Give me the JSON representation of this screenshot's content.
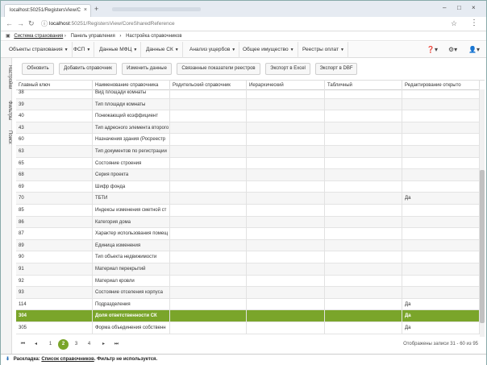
{
  "browser": {
    "tab_title": "localhost:50251/RegistersView/C",
    "url_host": "localhost",
    "url_rest": ":50251/RegistersView/CoreSharedReference"
  },
  "breadcrumb": [
    "Система страхования",
    "Панель управления",
    "Настройка справочников"
  ],
  "navbar": [
    "Объекты страхования",
    "ФСП",
    "Данные МФЦ",
    "Данные СК",
    "Анализ ущербов",
    "Общее имущество",
    "Реестры оплат"
  ],
  "side_tabs": [
    "Настройки",
    "Фильтры",
    "Поиск"
  ],
  "toolbar": [
    "Обновить",
    "Добавить справочник",
    "Изменить данные",
    "Связанные показатели реестров",
    "Экспорт в Excel",
    "Экспорт в DBF"
  ],
  "columns": [
    "Главный ключ",
    "Наименование справочника",
    "Родительский справочник",
    "Иерархический",
    "Табличный",
    "Редактирование открыто"
  ],
  "rows": [
    {
      "key": "38",
      "name": "Вид площади комнаты",
      "edit": ""
    },
    {
      "key": "39",
      "name": "Тип площади комнаты",
      "edit": ""
    },
    {
      "key": "40",
      "name": "Понижающий коэффициент",
      "edit": ""
    },
    {
      "key": "43",
      "name": "Тип адресного элемента второго",
      "edit": ""
    },
    {
      "key": "60",
      "name": "Назначения здания (Росреестр",
      "edit": ""
    },
    {
      "key": "63",
      "name": "Тип документов по регистрации",
      "edit": ""
    },
    {
      "key": "65",
      "name": "Состояние строения",
      "edit": ""
    },
    {
      "key": "68",
      "name": "Серия проекта",
      "edit": ""
    },
    {
      "key": "69",
      "name": "Шифр фонда",
      "edit": ""
    },
    {
      "key": "70",
      "name": "ТБТИ",
      "edit": "Да"
    },
    {
      "key": "85",
      "name": "Индексы изменения сметной ст",
      "edit": ""
    },
    {
      "key": "86",
      "name": "Категория дома",
      "edit": ""
    },
    {
      "key": "87",
      "name": "Характер использования помещ",
      "edit": ""
    },
    {
      "key": "89",
      "name": "Единица изменения",
      "edit": ""
    },
    {
      "key": "90",
      "name": "Тип объекта недвижимости",
      "edit": ""
    },
    {
      "key": "91",
      "name": "Материал перекрытий",
      "edit": ""
    },
    {
      "key": "92",
      "name": "Материал кровли",
      "edit": ""
    },
    {
      "key": "93",
      "name": "Состояние отселения корпуса",
      "edit": ""
    },
    {
      "key": "114",
      "name": "Подразделения",
      "edit": "Да"
    },
    {
      "key": "304",
      "name": "Доля ответственности СК",
      "edit": "Да",
      "selected": true
    },
    {
      "key": "305",
      "name": "Форма объединения собственн",
      "edit": "Да"
    }
  ],
  "pager": {
    "pages": [
      "1",
      "2",
      "3",
      "4"
    ],
    "current": "2",
    "info": "Отображены записи 31 - 60 из 95"
  },
  "status": {
    "label": "Раскладка:",
    "layout": "Список справочников",
    "filter": ". Фильтр не используется."
  }
}
